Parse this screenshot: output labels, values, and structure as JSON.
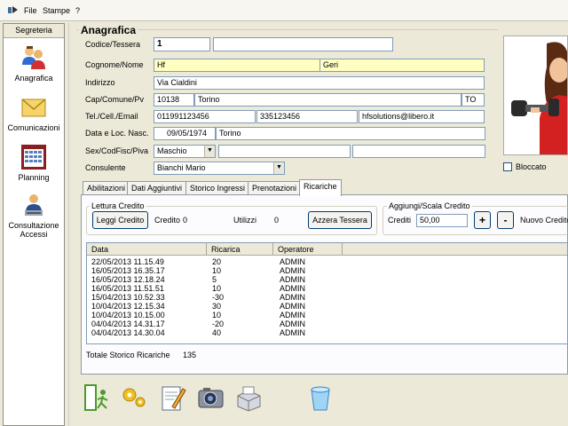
{
  "menu": {
    "items": [
      "File",
      "Stampe",
      "?"
    ]
  },
  "sidebar": {
    "title": "Segreteria",
    "items": [
      {
        "label": "Anagrafica",
        "icon": "users-icon"
      },
      {
        "label": "Comunicazioni",
        "icon": "envelope-icon"
      },
      {
        "label": "Planning",
        "icon": "calendar-icon"
      },
      {
        "label": "Consultazione Accessi",
        "icon": "access-log-icon"
      }
    ]
  },
  "anagrafica": {
    "title": "Anagrafica",
    "labels": {
      "codice": "Codice/Tessera",
      "cognome_nome": "Cognome/Nome",
      "indirizzo": "Indirizzo",
      "cap_comune": "Cap/Comune/Pv",
      "tel": "Tel./Cell./Email",
      "data_nasc": "Data e Loc. Nasc.",
      "sex": "Sex/CodFisc/Piva",
      "consulente": "Consulente"
    },
    "values": {
      "codice": "1",
      "tessera": "",
      "cognome": "Hf",
      "nome": "Geri",
      "indirizzo": "Via Cialdini",
      "cap": "10138",
      "comune": "Torino",
      "pv": "TO",
      "tel": "011991123456",
      "cell": "335123456",
      "email": "hfsolutions@libero.it",
      "data_nasc": "09/05/1974",
      "loc_nasc": "Torino",
      "sex": "Maschio",
      "codfisc": "",
      "piva": "",
      "consulente": "Bianchi Mario"
    },
    "bloccato_label": "Bloccato",
    "bloccato_checked": false
  },
  "tabs": [
    "Abilitazioni",
    "Dati Aggiuntivi",
    "Storico Ingressi",
    "Prenotazioni",
    "Ricariche"
  ],
  "active_tab": "Ricariche",
  "lettura": {
    "title": "Lettura Credito",
    "leggi_button": "Leggi Credito",
    "credito_label": "Credito",
    "credito_value": "0",
    "utilizzi_label": "Utilizzi",
    "utilizzi_value": "0",
    "azzera_button": "Azzera Tessera"
  },
  "aggiungi": {
    "title": "Aggiungi/Scala Credito",
    "crediti_label": "Crediti",
    "crediti_value": "50,00",
    "plus_label": "+",
    "minus_label": "-",
    "nuovo_label": "Nuovo Credito"
  },
  "ricariche": {
    "columns": [
      "Data",
      "Ricarica",
      "Operatore"
    ],
    "rows": [
      [
        "22/05/2013 11.15.49",
        "20",
        "ADMIN"
      ],
      [
        "16/05/2013 16.35.17",
        "10",
        "ADMIN"
      ],
      [
        "16/05/2013 12.18.24",
        "5",
        "ADMIN"
      ],
      [
        "16/05/2013 11.51.51",
        "10",
        "ADMIN"
      ],
      [
        "15/04/2013 10.52.33",
        "-30",
        "ADMIN"
      ],
      [
        "10/04/2013 12.15.34",
        "30",
        "ADMIN"
      ],
      [
        "10/04/2013 10.15.00",
        "10",
        "ADMIN"
      ],
      [
        "04/04/2013 14.31.17",
        "-20",
        "ADMIN"
      ],
      [
        "04/04/2013 14.30.04",
        "40",
        "ADMIN"
      ]
    ],
    "totale_label": "Totale Storico Ricariche",
    "totale_value": "135"
  },
  "toolbar": {
    "buttons": [
      "exit-icon",
      "gear-icon",
      "edit-icon",
      "camera-icon",
      "print-icon",
      "trash-icon"
    ]
  }
}
